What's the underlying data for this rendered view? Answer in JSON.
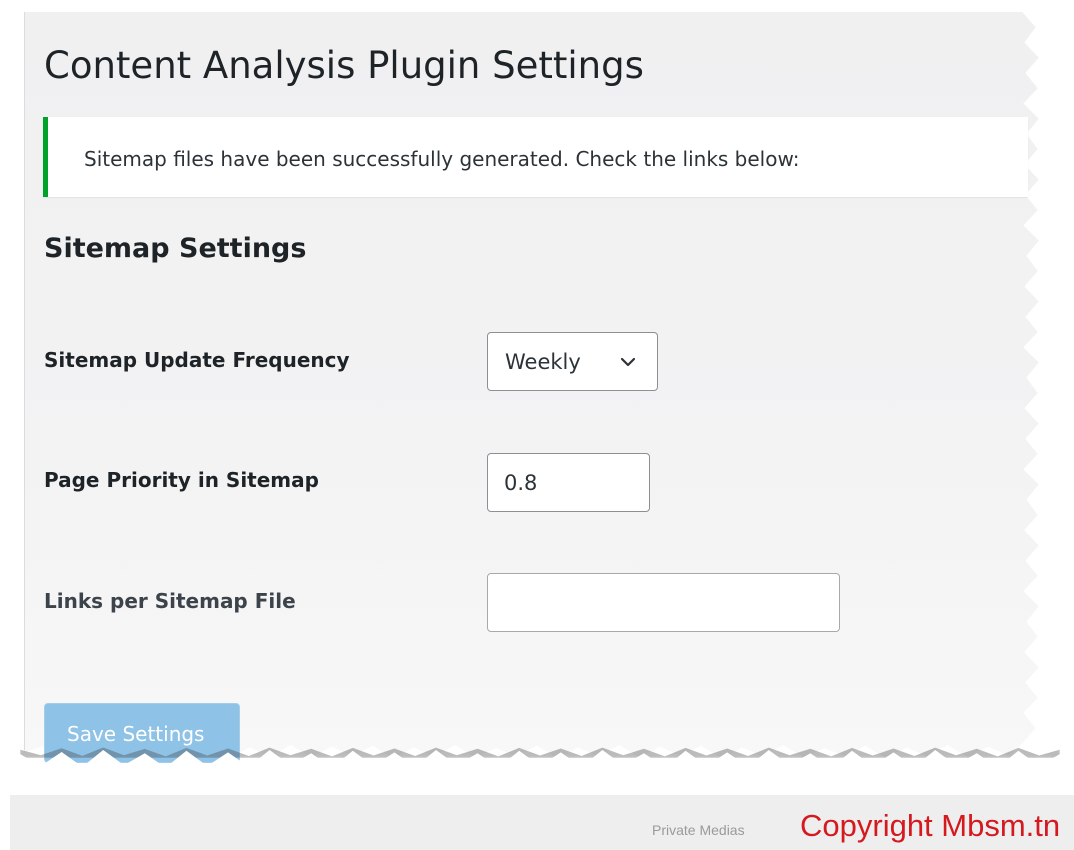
{
  "page": {
    "title": "Content Analysis Plugin Settings"
  },
  "notice": {
    "message": "Sitemap files have been successfully generated. Check the links below:",
    "status_color": "#00a32a"
  },
  "section": {
    "title": "Sitemap Settings"
  },
  "fields": {
    "frequency": {
      "label": "Sitemap Update Frequency",
      "selected": "Weekly",
      "icon": "chevron-down-icon"
    },
    "priority": {
      "label": "Page Priority in Sitemap",
      "value": "0.8"
    },
    "links": {
      "label": "Links per Sitemap File",
      "value": ""
    }
  },
  "actions": {
    "save_label": "Save Settings",
    "button_color": "#8ec2e6"
  },
  "footer": {
    "small_text": "Private Medias",
    "copyright": "Copyright Mbsm.tn",
    "copyright_color": "#d4191f"
  }
}
